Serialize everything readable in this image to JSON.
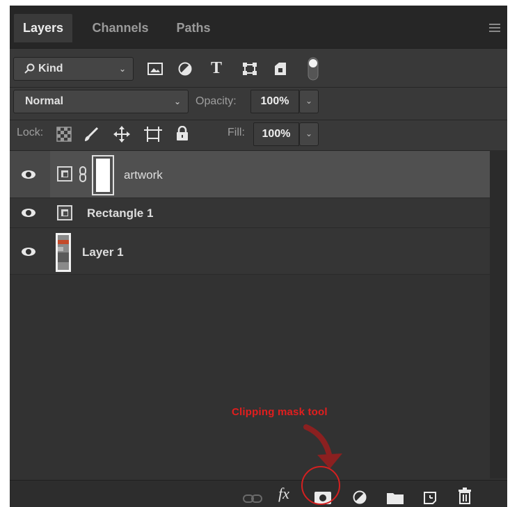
{
  "tabs": [
    {
      "label": "Layers",
      "active": true
    },
    {
      "label": "Channels",
      "active": false
    },
    {
      "label": "Paths",
      "active": false
    }
  ],
  "filter": {
    "kind_label": "Kind",
    "icons": [
      "image-filter-icon",
      "adjustment-filter-icon",
      "type-filter-icon",
      "shape-filter-icon",
      "smart-object-filter-icon",
      "filter-toggle-icon"
    ]
  },
  "blend": {
    "mode": "Normal",
    "opacity_label": "Opacity:",
    "opacity_value": "100%"
  },
  "lock": {
    "label": "Lock:",
    "icons": [
      "lock-transparent-icon",
      "lock-image-icon",
      "lock-position-icon",
      "lock-artboard-icon",
      "lock-all-icon"
    ],
    "fill_label": "Fill:",
    "fill_value": "100%"
  },
  "layers": [
    {
      "name": "artwork",
      "type": "smart-object-with-mask",
      "visible": true,
      "selected": true
    },
    {
      "name": "Rectangle 1",
      "type": "smart-object",
      "visible": true,
      "selected": false
    },
    {
      "name": "Layer 1",
      "type": "image",
      "visible": true,
      "selected": false
    }
  ],
  "toolbar": {
    "fx_label": "fx",
    "icons": [
      "link-layers-icon",
      "fx-icon",
      "add-mask-icon",
      "adjustment-layer-icon",
      "group-folder-icon",
      "new-layer-icon",
      "trash-icon"
    ]
  },
  "annotation": {
    "text": "Clipping mask tool",
    "color": "#e21e1e"
  },
  "colors": {
    "panel": "#323232",
    "selected_row": "#484848",
    "annotation": "#e21e1e"
  }
}
